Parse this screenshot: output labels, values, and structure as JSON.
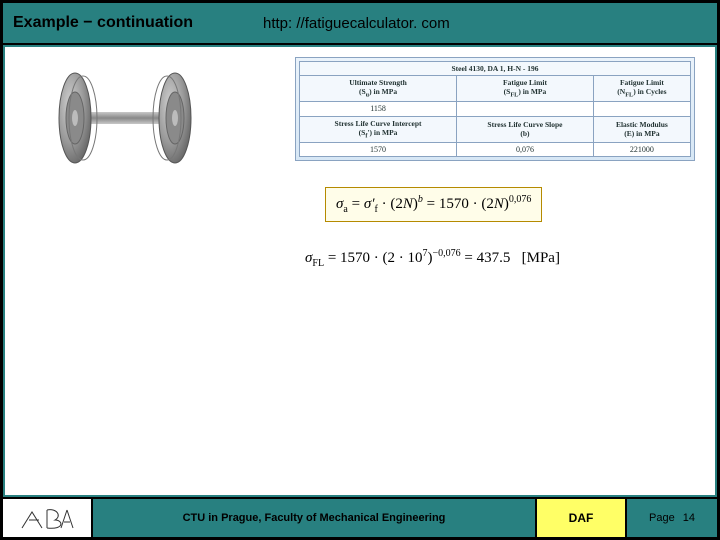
{
  "header": {
    "title": "Example − continuation",
    "url": "http: //fatiguecalculator. com"
  },
  "wheelset": {
    "alt": "railway-wheelset"
  },
  "table": {
    "material": "Steel 4130, DA 1, H-N - 196",
    "cols1": [
      {
        "label": "Ultimate Strength",
        "unit": "(S<sub>u</sub>) in MPa"
      },
      {
        "label": "Fatigue Limit",
        "unit": "(S<sub>FL</sub>) in MPa"
      },
      {
        "label": "Fatigue Limit",
        "unit": "(N<sub>FL</sub>) in Cycles"
      }
    ],
    "vals1": [
      "1158",
      "",
      ""
    ],
    "cols2": [
      {
        "label": "Stress Life Curve Intercept",
        "unit": "(S<sub>f</sub>') in MPa"
      },
      {
        "label": "Stress Life Curve Slope",
        "unit": "(b)"
      },
      {
        "label": "Elastic Modulus",
        "unit": "(E) in MPa"
      }
    ],
    "vals2": [
      "1570",
      "0,076",
      "221000"
    ]
  },
  "formula1": {
    "display": "σ<sub>a</sub> = σ′<sub>f</sub> · (2N)<sup>b</sup> = 1570 · (2N)<sup>0,076</sup>"
  },
  "formula2": {
    "display": "σ<sub>FL</sub> = 1570 · (2 · 10<sup>7</sup>)<sup>−0,076</sup> = 437.5   [MPa]"
  },
  "footer": {
    "university": "CTU in Prague, Faculty of Mechanical Engineering",
    "daf": "DAF",
    "page_label": "Page",
    "page_number": "14"
  }
}
